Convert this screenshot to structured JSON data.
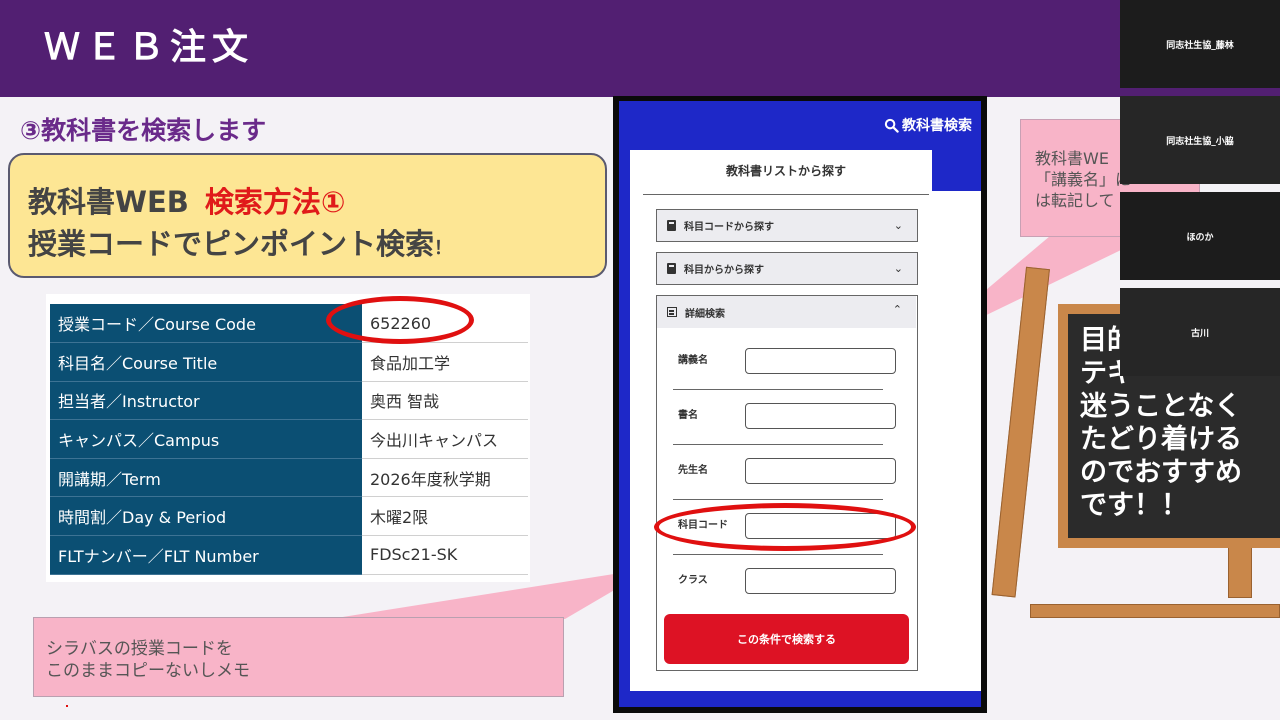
{
  "header": {
    "title": "ＷＥＢ注文"
  },
  "slide": {
    "step_title": "③教科書を検索します",
    "method": {
      "line1_a": "教科書WEB",
      "line1_b": "検索方法①",
      "line2_a": "授業コードでピンポイント検索",
      "line2_b": "！"
    },
    "course_table": [
      {
        "key": "授業コード／Course Code",
        "value": "652260"
      },
      {
        "key": "科目名／Course Title",
        "value": "食品加工学"
      },
      {
        "key": "担当者／Instructor",
        "value": "奥西 智哉"
      },
      {
        "key": "キャンパス／Campus",
        "value": "今出川キャンパス"
      },
      {
        "key": "開講期／Term",
        "value": "2026年度秋学期"
      },
      {
        "key": "時間割／Day & Period",
        "value": "木曜2限"
      },
      {
        "key": "FLTナンバー／FLT Number",
        "value": "FDSc21-SK"
      }
    ],
    "callout_left": {
      "line1": "シラバスの授業コードを",
      "line2": "このままコピーないしメモ"
    },
    "callout_right": {
      "line1": "教科書WE",
      "line2": "「講義名」に",
      "line3": "は転記して"
    },
    "board": {
      "line1": "目的",
      "line2": "テキ",
      "line3": "迷うことなく",
      "line4": "たどり着ける",
      "line5": "のでおすすめ",
      "line6": "です！！"
    }
  },
  "phone": {
    "search_label": "教科書検索",
    "tab_label": "教科書リストから探す",
    "accordions": [
      {
        "label": "科目コードから探す"
      },
      {
        "label": "科目からから探す"
      }
    ],
    "detail": {
      "label": "詳細検索",
      "fields": [
        {
          "label": "講義名",
          "value": ""
        },
        {
          "label": "書名",
          "value": ""
        },
        {
          "label": "先生名",
          "value": ""
        },
        {
          "label": "科目コード",
          "value": ""
        },
        {
          "label": "クラス",
          "value": ""
        }
      ],
      "submit_label": "この条件で検索する"
    }
  },
  "participants": [
    {
      "name": "同志社生協_藤林"
    },
    {
      "name": "同志社生協_小脇"
    },
    {
      "name": "ほのか"
    },
    {
      "name": "古川"
    }
  ],
  "colors": {
    "header": "#521f72",
    "accent_red": "#e01010",
    "table_key": "#0b4f73",
    "phone_blue": "#1e28c8",
    "submit_red": "#dd1224",
    "callout_pink": "#f8b4c8",
    "method_yellow": "#fde694"
  }
}
